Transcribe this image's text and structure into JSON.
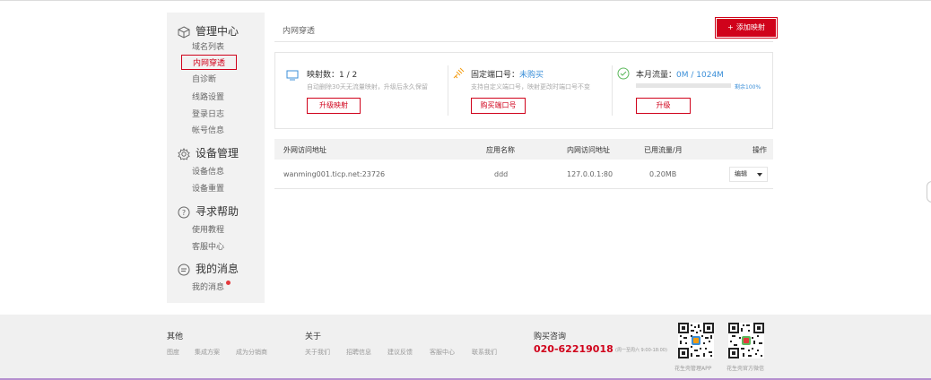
{
  "sidebar": {
    "sections": [
      {
        "title": "管理中心",
        "icon": "cube-icon",
        "items": [
          {
            "label": "域名列表",
            "active": false
          },
          {
            "label": "内网穿透",
            "active": true
          },
          {
            "label": "自诊断",
            "active": false
          },
          {
            "label": "线路设置",
            "active": false
          },
          {
            "label": "登录日志",
            "active": false
          },
          {
            "label": "帐号信息",
            "active": false
          }
        ]
      },
      {
        "title": "设备管理",
        "icon": "gear-icon",
        "items": [
          {
            "label": "设备信息"
          },
          {
            "label": "设备重置"
          }
        ]
      },
      {
        "title": "寻求帮助",
        "icon": "question-icon",
        "items": [
          {
            "label": "使用教程"
          },
          {
            "label": "客服中心"
          }
        ]
      },
      {
        "title": "我的消息",
        "icon": "chat-icon",
        "items": [
          {
            "label": "我的消息",
            "has_unread_dot": true
          }
        ]
      }
    ]
  },
  "main": {
    "breadcrumb": "内网穿透",
    "add_button": {
      "plus": "+",
      "label": "添加映射"
    },
    "stats": [
      {
        "icon": "monitor-icon",
        "label": "映射数：",
        "value": "1 / 2",
        "sub": "自动删除30天无流量映射，升级后永久保留",
        "button": "升级映射"
      },
      {
        "icon": "plug-icon",
        "label": "固定端口号：",
        "value": "未购买",
        "sub": "支持自定义端口号，映射更改时端口号不变",
        "button": "购买端口号"
      },
      {
        "icon": "check-circle-icon",
        "label": "本月流量：",
        "value": "0M / 1024M",
        "remaining": "剩余100%",
        "remaining_fraction": 1.0,
        "button": "升级"
      }
    ],
    "table": {
      "headers": [
        "外网访问地址",
        "应用名称",
        "内网访问地址",
        "已用流量/月",
        "操作"
      ],
      "rows": [
        {
          "external": "wanming001.ticp.net:23726",
          "app": "ddd",
          "internal": "127.0.0.1:80",
          "used": "0.20MB",
          "action": "编辑"
        }
      ]
    }
  },
  "footer": {
    "other": {
      "title": "其他",
      "links": [
        "图度",
        "集成方案",
        "成为分销商"
      ]
    },
    "about": {
      "title": "关于",
      "links": [
        "关于我们",
        "招聘信息",
        "建议反馈",
        "客服中心",
        "联系我们"
      ]
    },
    "purchase": {
      "title": "购买咨询",
      "phone": "020-62219018",
      "hours": "(周一至周六 9:00-18:00)"
    },
    "qr_codes": [
      {
        "caption": "花生壳管理APP"
      },
      {
        "caption": "花生壳官方微信"
      }
    ]
  },
  "colors": {
    "accent": "#d0021b",
    "link": "#3b8fd8",
    "sidebar_bg": "#f2f2f2",
    "footer_border": "#b58fcf"
  }
}
